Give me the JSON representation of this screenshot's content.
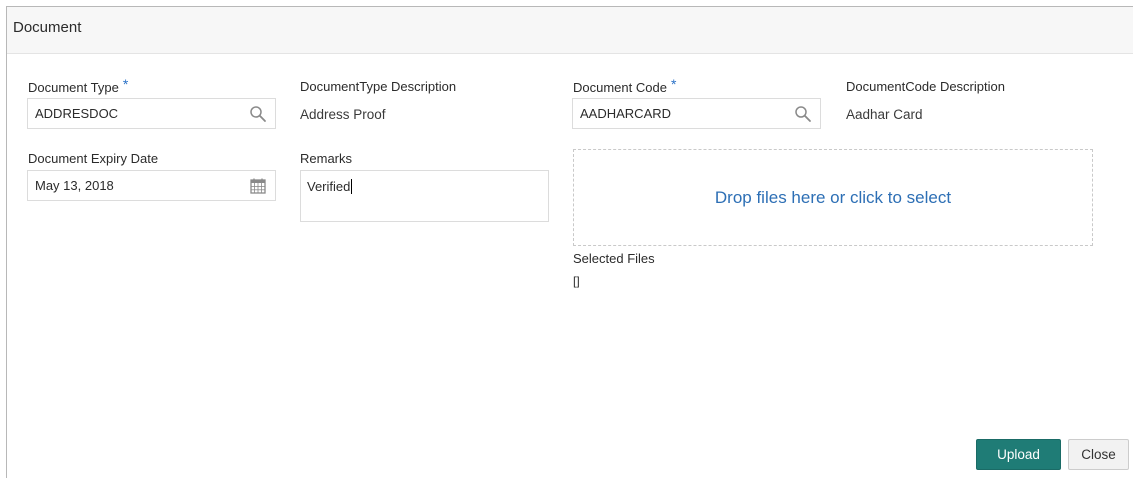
{
  "dialog": {
    "title": "Document"
  },
  "form": {
    "required_mark": "*",
    "document_type": {
      "label": "Document Type",
      "value": "ADDRESDOC",
      "icon": "search-icon"
    },
    "document_type_description": {
      "label": "DocumentType Description",
      "value": "Address Proof"
    },
    "document_code": {
      "label": "Document Code",
      "value": "AADHARCARD",
      "icon": "search-icon"
    },
    "document_code_description": {
      "label": "DocumentCode Description",
      "value": "Aadhar Card"
    },
    "document_expiry_date": {
      "label": "Document Expiry Date",
      "value": "May 13, 2018",
      "icon": "calendar-icon"
    },
    "remarks": {
      "label": "Remarks",
      "value": "Verified"
    }
  },
  "dropzone": {
    "text": "Drop files here or click to select"
  },
  "selected_files": {
    "label": "Selected Files",
    "value": "[]"
  },
  "buttons": {
    "upload": "Upload",
    "close": "Close"
  },
  "colors": {
    "accent_link": "#2d6fb5",
    "required_mark": "#2c72c7",
    "upload_button": "#1f7c76"
  }
}
